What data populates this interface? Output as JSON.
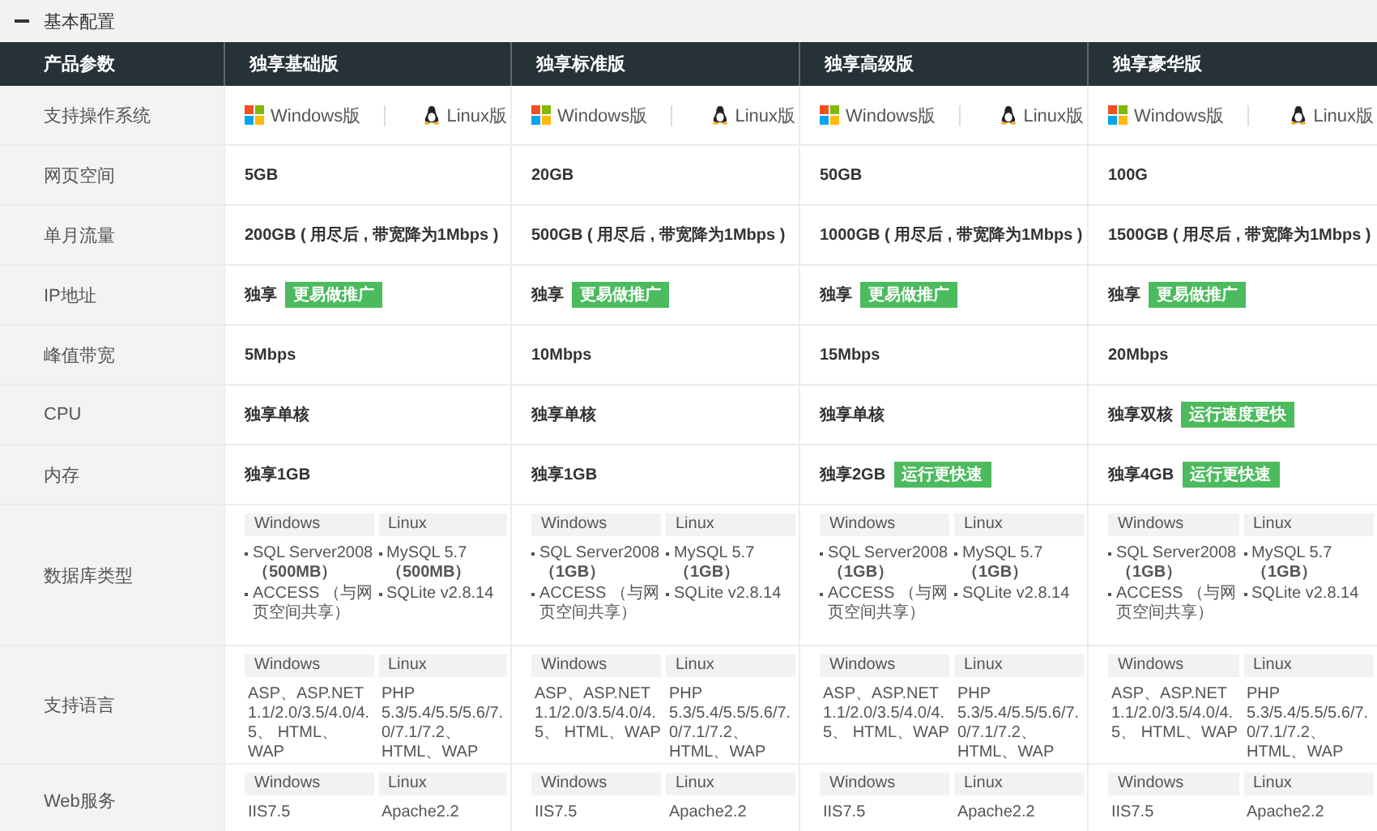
{
  "section": {
    "title": "基本配置",
    "expanded": true
  },
  "table": {
    "corner": "产品参数",
    "columns": [
      "独享基础版",
      "独享标准版",
      "独享高级版",
      "独享豪华版"
    ],
    "rows": [
      {
        "label": "支持操作系统",
        "kind": "os",
        "cells": [
          {
            "options": [
              "Windows版",
              "Linux版"
            ]
          },
          {
            "options": [
              "Windows版",
              "Linux版"
            ]
          },
          {
            "options": [
              "Windows版",
              "Linux版"
            ]
          },
          {
            "options": [
              "Windows版",
              "Linux版"
            ]
          }
        ]
      },
      {
        "label": "网页空间",
        "kind": "text",
        "cells": [
          {
            "text": "5GB"
          },
          {
            "text": "20GB"
          },
          {
            "text": "50GB"
          },
          {
            "text": "100G"
          }
        ]
      },
      {
        "label": "单月流量",
        "kind": "text",
        "cells": [
          {
            "text": "200GB ( 用尽后 , 带宽降为1Mbps )"
          },
          {
            "text": "500GB ( 用尽后 , 带宽降为1Mbps )"
          },
          {
            "text": "1000GB ( 用尽后 , 带宽降为1Mbps )"
          },
          {
            "text": "1500GB ( 用尽后 , 带宽降为1Mbps )"
          }
        ]
      },
      {
        "label": "IP地址",
        "kind": "text",
        "cells": [
          {
            "text": "独享",
            "badge": "更易做推广"
          },
          {
            "text": "独享",
            "badge": "更易做推广"
          },
          {
            "text": "独享",
            "badge": "更易做推广"
          },
          {
            "text": "独享",
            "badge": "更易做推广"
          }
        ]
      },
      {
        "label": "峰值带宽",
        "kind": "text",
        "cells": [
          {
            "text": "5Mbps"
          },
          {
            "text": "10Mbps"
          },
          {
            "text": "15Mbps"
          },
          {
            "text": "20Mbps"
          }
        ]
      },
      {
        "label": "CPU",
        "kind": "text",
        "cells": [
          {
            "text": "独享单核"
          },
          {
            "text": "独享单核"
          },
          {
            "text": "独享单核"
          },
          {
            "text": "独享双核",
            "badge": "运行速度更快"
          }
        ]
      },
      {
        "label": "内存",
        "kind": "text",
        "cells": [
          {
            "text": "独享1GB"
          },
          {
            "text": "独享1GB"
          },
          {
            "text": "独享2GB",
            "badge": "运行更快速"
          },
          {
            "text": "独享4GB",
            "badge": "运行更快速"
          }
        ]
      },
      {
        "label": "数据库类型",
        "kind": "list",
        "cells": [
          {
            "groups": [
              {
                "name": "Windows",
                "items": [
                  "SQL Server2008 **（500MB）**",
                  "ACCESS （与网页空间共享）"
                ]
              },
              {
                "name": "Linux",
                "items": [
                  "MySQL 5.7 **（500MB）**",
                  "SQLite v2.8.14"
                ]
              }
            ]
          },
          {
            "groups": [
              {
                "name": "Windows",
                "items": [
                  "SQL Server2008 **（1GB）**",
                  "ACCESS （与网页空间共享）"
                ]
              },
              {
                "name": "Linux",
                "items": [
                  "MySQL 5.7 **（1GB）**",
                  "SQLite v2.8.14"
                ]
              }
            ]
          },
          {
            "groups": [
              {
                "name": "Windows",
                "items": [
                  "SQL Server2008 **（1GB）**",
                  "ACCESS （与网页空间共享）"
                ]
              },
              {
                "name": "Linux",
                "items": [
                  "MySQL 5.7 **（1GB）**",
                  "SQLite v2.8.14"
                ]
              }
            ]
          },
          {
            "groups": [
              {
                "name": "Windows",
                "items": [
                  "SQL Server2008 **（1GB）**",
                  "ACCESS （与网页空间共享）"
                ]
              },
              {
                "name": "Linux",
                "items": [
                  "MySQL 5.7 **（1GB）**",
                  "SQLite v2.8.14"
                ]
              }
            ]
          }
        ]
      },
      {
        "label": "支持语言",
        "kind": "split",
        "cells": [
          {
            "groups": [
              {
                "name": "Windows",
                "items": [
                  "ASP、ASP.NET 1.1/2.0/3.5/4.0/4.5、 HTML、WAP"
                ]
              },
              {
                "name": "Linux",
                "items": [
                  "PHP 5.3/5.4/5.5/5.6/7.0/7.1/7.2、HTML、WAP"
                ]
              }
            ]
          },
          {
            "groups": [
              {
                "name": "Windows",
                "items": [
                  "ASP、ASP.NET 1.1/2.0/3.5/4.0/4.5、 HTML、WAP"
                ]
              },
              {
                "name": "Linux",
                "items": [
                  "PHP 5.3/5.4/5.5/5.6/7.0/7.1/7.2、HTML、WAP"
                ]
              }
            ]
          },
          {
            "groups": [
              {
                "name": "Windows",
                "items": [
                  "ASP、ASP.NET 1.1/2.0/3.5/4.0/4.5、 HTML、WAP"
                ]
              },
              {
                "name": "Linux",
                "items": [
                  "PHP 5.3/5.4/5.5/5.6/7.0/7.1/7.2、HTML、WAP"
                ]
              }
            ]
          },
          {
            "groups": [
              {
                "name": "Windows",
                "items": [
                  "ASP、ASP.NET 1.1/2.0/3.5/4.0/4.5、 HTML、WAP"
                ]
              },
              {
                "name": "Linux",
                "items": [
                  "PHP 5.3/5.4/5.5/5.6/7.0/7.1/7.2、HTML、WAP"
                ]
              }
            ]
          }
        ]
      },
      {
        "label": "Web服务",
        "kind": "split",
        "cells": [
          {
            "groups": [
              {
                "name": "Windows",
                "items": [
                  "IIS7.5"
                ]
              },
              {
                "name": "Linux",
                "items": [
                  "Apache2.2"
                ]
              }
            ]
          },
          {
            "groups": [
              {
                "name": "Windows",
                "items": [
                  "IIS7.5"
                ]
              },
              {
                "name": "Linux",
                "items": [
                  "Apache2.2"
                ]
              }
            ]
          },
          {
            "groups": [
              {
                "name": "Windows",
                "items": [
                  "IIS7.5"
                ]
              },
              {
                "name": "Linux",
                "items": [
                  "Apache2.2"
                ]
              }
            ]
          },
          {
            "groups": [
              {
                "name": "Windows",
                "items": [
                  "IIS7.5"
                ]
              },
              {
                "name": "Linux",
                "items": [
                  "Apache2.2"
                ]
              }
            ]
          }
        ]
      }
    ]
  }
}
